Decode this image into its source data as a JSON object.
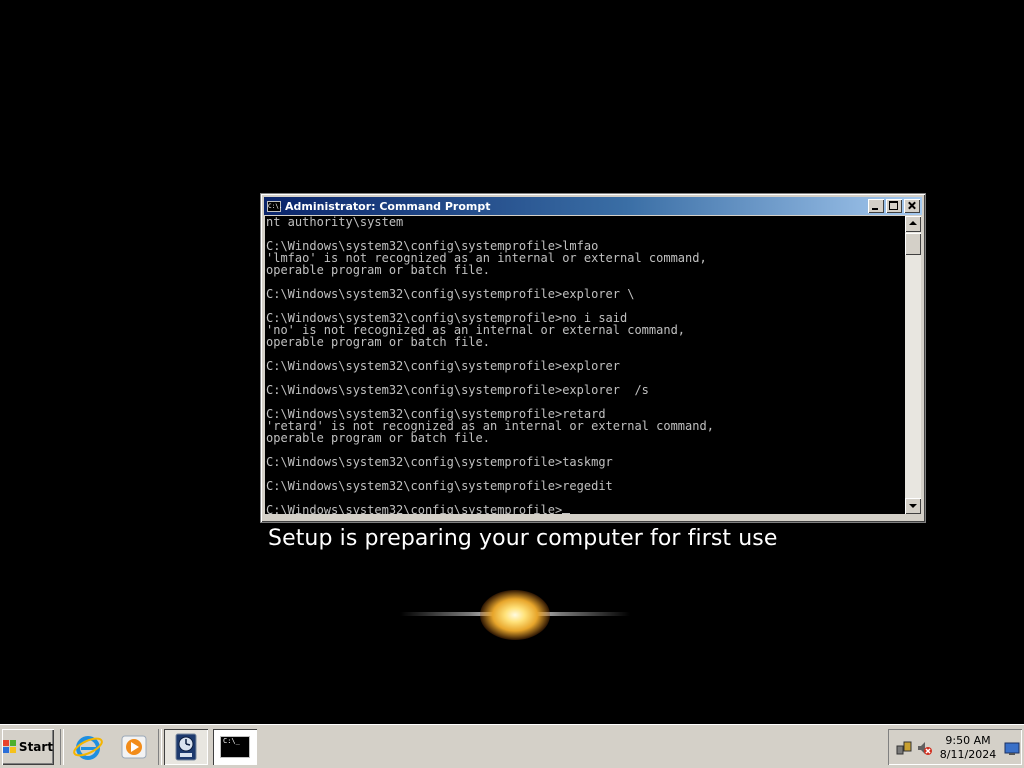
{
  "setup": {
    "message": "Setup is preparing your computer for first use"
  },
  "console": {
    "title": "Administrator: Command Prompt",
    "icon_text": "C:\\.",
    "lines": [
      "nt authority\\system",
      "",
      "C:\\Windows\\system32\\config\\systemprofile>lmfao",
      "'lmfao' is not recognized as an internal or external command,",
      "operable program or batch file.",
      "",
      "C:\\Windows\\system32\\config\\systemprofile>explorer \\",
      "",
      "C:\\Windows\\system32\\config\\systemprofile>no i said",
      "'no' is not recognized as an internal or external command,",
      "operable program or batch file.",
      "",
      "C:\\Windows\\system32\\config\\systemprofile>explorer",
      "",
      "C:\\Windows\\system32\\config\\systemprofile>explorer  /s",
      "",
      "C:\\Windows\\system32\\config\\systemprofile>retard",
      "'retard' is not recognized as an internal or external command,",
      "operable program or batch file.",
      "",
      "C:\\Windows\\system32\\config\\systemprofile>taskmgr",
      "",
      "C:\\Windows\\system32\\config\\systemprofile>regedit",
      "",
      "C:\\Windows\\system32\\config\\systemprofile>"
    ],
    "colors": {
      "text": "#c0c0c0",
      "background": "#000000"
    }
  },
  "taskbar": {
    "start_label": "Start",
    "quick_launch": [
      "internet-explorer-icon",
      "media-player-icon"
    ],
    "task_buttons": [
      "system-clock-app-icon",
      "command-prompt-icon"
    ],
    "active_task": "command-prompt-icon",
    "console_icon_text": "C:\\_"
  },
  "tray": {
    "time": "9:50 AM",
    "date": "8/11/2024",
    "icons": [
      "network-icon",
      "volume-muted-icon",
      "show-desktop-icon"
    ]
  }
}
